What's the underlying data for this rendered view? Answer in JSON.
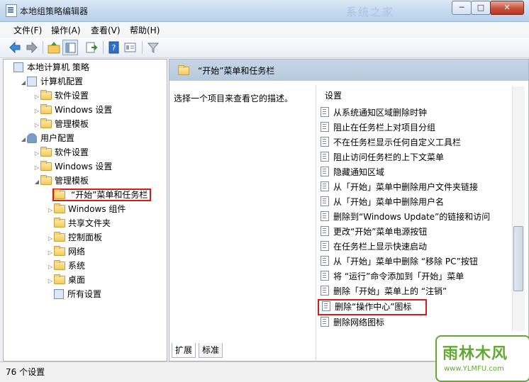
{
  "window": {
    "title": "本地组策略编辑器"
  },
  "caption_buttons": {
    "minimize": "─",
    "maximize": "□",
    "close": "✕"
  },
  "menu": [
    "文件(F)",
    "操作(A)",
    "查看(V)",
    "帮助(H)"
  ],
  "toolbar_icons": [
    "back-arrow-icon",
    "forward-arrow-icon",
    "up-folder-icon",
    "show-hide-tree-icon",
    "export-list-icon",
    "help-icon",
    "properties-icon",
    "filter-icon"
  ],
  "tree": [
    {
      "label": "本地计算机 策略",
      "indent": 0,
      "arrow": "",
      "icon": "policy-icon"
    },
    {
      "label": "计算机配置",
      "indent": 1,
      "arrow": "◢",
      "icon": "computer-icon"
    },
    {
      "label": "软件设置",
      "indent": 2,
      "arrow": "▷",
      "icon": "folder-icon"
    },
    {
      "label": "Windows 设置",
      "indent": 2,
      "arrow": "▷",
      "icon": "folder-icon"
    },
    {
      "label": "管理模板",
      "indent": 2,
      "arrow": "▷",
      "icon": "folder-icon"
    },
    {
      "label": "用户配置",
      "indent": 1,
      "arrow": "◢",
      "icon": "user-icon"
    },
    {
      "label": "软件设置",
      "indent": 2,
      "arrow": "▷",
      "icon": "folder-icon"
    },
    {
      "label": "Windows 设置",
      "indent": 2,
      "arrow": "▷",
      "icon": "folder-icon"
    },
    {
      "label": "管理模板",
      "indent": 2,
      "arrow": "◢",
      "icon": "folder-icon"
    },
    {
      "label": "“开始”菜单和任务栏",
      "indent": 3,
      "arrow": "",
      "icon": "folder-icon",
      "highlighted": true
    },
    {
      "label": "Windows 组件",
      "indent": 3,
      "arrow": "▷",
      "icon": "folder-icon"
    },
    {
      "label": "共享文件夹",
      "indent": 3,
      "arrow": "",
      "icon": "folder-icon"
    },
    {
      "label": "控制面板",
      "indent": 3,
      "arrow": "▷",
      "icon": "folder-icon"
    },
    {
      "label": "网络",
      "indent": 3,
      "arrow": "▷",
      "icon": "folder-icon"
    },
    {
      "label": "系统",
      "indent": 3,
      "arrow": "▷",
      "icon": "folder-icon"
    },
    {
      "label": "桌面",
      "indent": 3,
      "arrow": "▷",
      "icon": "folder-icon"
    },
    {
      "label": "所有设置",
      "indent": 3,
      "arrow": "",
      "icon": "all-settings-icon"
    }
  ],
  "right": {
    "header": "“开始”菜单和任务栏",
    "description": "选择一个项目来查看它的描述。",
    "column_header": "设置",
    "settings": [
      {
        "label": "从系统通知区域删除时钟"
      },
      {
        "label": "阻止在任务栏上对项目分组"
      },
      {
        "label": "不在任务栏显示任何自定义工具栏"
      },
      {
        "label": "阻止访问任务栏的上下文菜单"
      },
      {
        "label": "隐藏通知区域"
      },
      {
        "label": "从「开始」菜单中删除用户文件夹链接"
      },
      {
        "label": "从「开始」菜单中删除用户名"
      },
      {
        "label": "删除到“Windows Update”的链接和访问"
      },
      {
        "label": "更改“开始”菜单电源按钮"
      },
      {
        "label": "在任务栏上显示快速启动"
      },
      {
        "label": "从「开始」菜单中删除 “移除 PC”按钮"
      },
      {
        "label": "将 “运行”命令添加到「开始」菜单"
      },
      {
        "label": "删除「开始」菜单上的 “注销”"
      },
      {
        "label": "删除“操作中心”图标",
        "highlighted": true
      },
      {
        "label": "删除网络图标"
      }
    ]
  },
  "tabs": [
    "扩展",
    "标准"
  ],
  "status": "76 个设置",
  "watermark": {
    "text": "雨林木风",
    "url": "www.YLMFU.com",
    "faded": "系统之家"
  },
  "colors": {
    "highlight_border": "#d11d1d",
    "header_bg": "#b6c9dd",
    "watermark_green": "#64a833"
  }
}
